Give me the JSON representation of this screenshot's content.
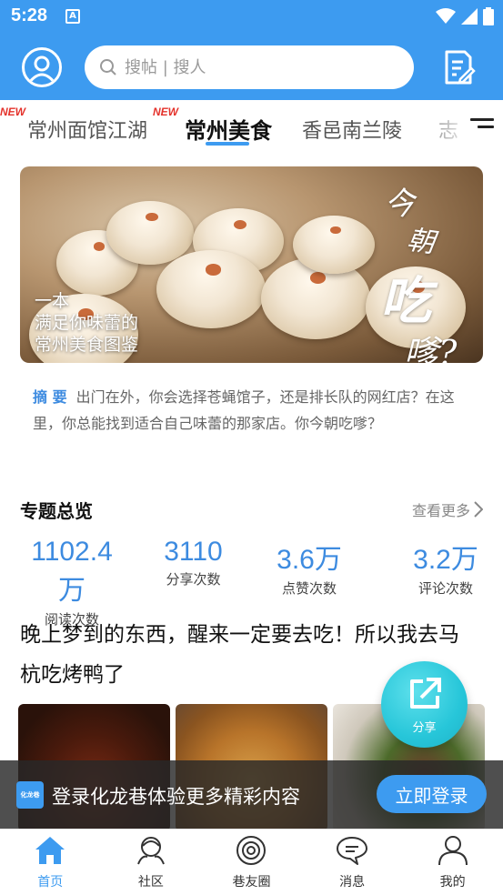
{
  "status_bar": {
    "time": "5:28",
    "notification_icon": "A"
  },
  "header": {
    "search_placeholder": "搜帖 | 搜人",
    "avatar_icon": "user-icon",
    "edit_icon": "edit-icon"
  },
  "tabs": [
    {
      "label": "常州面馆江湖",
      "badge": "NEW"
    },
    {
      "label": "常州美食",
      "badge": "NEW",
      "active": true
    },
    {
      "label": "香邑南兰陵"
    },
    {
      "label": "志"
    }
  ],
  "banner": {
    "caption_line1": "一本",
    "caption_line2": "满足你味蕾的",
    "caption_line3": "常州美食图鉴",
    "script_1": "今",
    "script_2": "朝",
    "script_3": "吃",
    "script_4": "嗲?"
  },
  "summary": {
    "tag": "摘 要",
    "text": "出门在外，你会选择苍蝇馆子，还是排长队的网红店？在这里，你总能找到适合自己味蕾的那家店。你今朝吃嗲？"
  },
  "overview": {
    "title": "专题总览",
    "see_more": "查看更多",
    "stats": [
      {
        "value": "1102.4万",
        "label": "阅读次数"
      },
      {
        "value": "3110",
        "label": "分享次数"
      },
      {
        "value": "3.6万",
        "label": "点赞次数"
      },
      {
        "value": "3.2万",
        "label": "评论次数"
      }
    ]
  },
  "article": {
    "title": "晚上梦到的东西，醒来一定要去吃！所以我去马杭吃烤鸭了"
  },
  "share": {
    "label": "分享"
  },
  "login_prompt": {
    "logo_text": "化龙巷",
    "text": "登录化龙巷体验更多精彩内容",
    "button": "立即登录"
  },
  "bottom_nav": [
    {
      "label": "首页",
      "icon": "home-icon",
      "active": true
    },
    {
      "label": "社区",
      "icon": "community-icon"
    },
    {
      "label": "巷友圈",
      "icon": "circle-icon"
    },
    {
      "label": "消息",
      "icon": "message-icon"
    },
    {
      "label": "我的",
      "icon": "profile-icon"
    }
  ],
  "colors": {
    "primary": "#3d9bf0",
    "accent_text": "#3d8be0",
    "badge": "#e4322b",
    "share": "#27c6d9"
  }
}
